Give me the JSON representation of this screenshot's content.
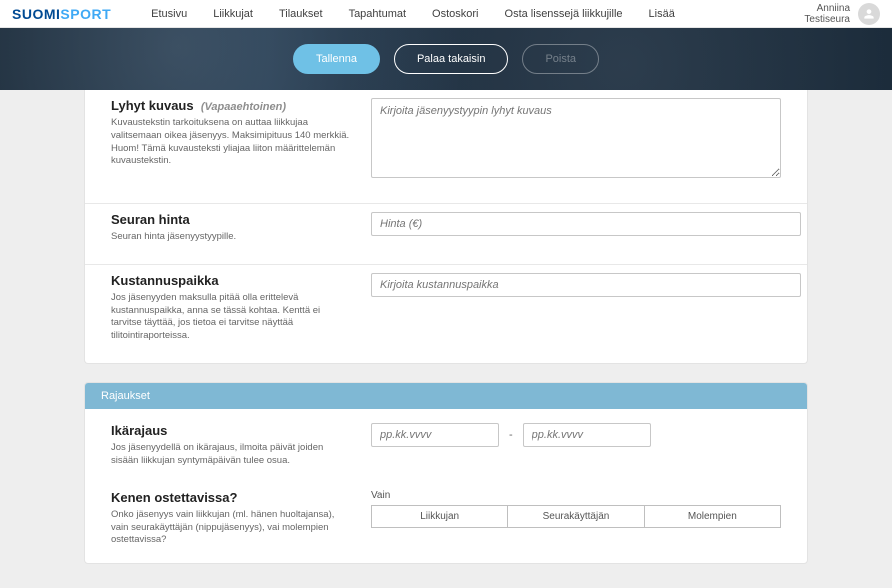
{
  "header": {
    "logo_part1": "SUOMI",
    "logo_part2": "SPORT",
    "nav": [
      "Etusivu",
      "Liikkujat",
      "Tilaukset",
      "Tapahtumat",
      "Ostoskori",
      "Osta lisenssejä liikkujille",
      "Lisää"
    ],
    "user_name": "Anniina",
    "user_org": "Testiseura"
  },
  "hero": {
    "save": "Tallenna",
    "back": "Palaa takaisin",
    "delete": "Poista"
  },
  "form": {
    "short_desc_label": "Lyhyt kuvaus",
    "short_desc_optional": "(Vapaaehtoinen)",
    "short_desc_help": "Kuvaustekstin tarkoituksena on auttaa liikkujaa valitsemaan oikea jäsenyys. Maksimipituus 140 merkkiä. Huom! Tämä kuvausteksti yliajaa liiton määrittelemän kuvaustekstin.",
    "short_desc_placeholder": "Kirjoita jäsenyystyypin lyhyt kuvaus",
    "club_price_label": "Seuran hinta",
    "club_price_help": "Seuran hinta jäsenyystyypille.",
    "club_price_placeholder": "Hinta (€)",
    "cost_center_label": "Kustannuspaikka",
    "cost_center_help": "Jos jäsenyyden maksulla pitää olla erittelevä kustannuspaikka, anna se tässä kohtaa. Kenttä ei tarvitse täyttää, jos tietoa ei tarvitse näyttää tilitointiraporteissa.",
    "cost_center_placeholder": "Kirjoita kustannuspaikka"
  },
  "limits": {
    "stripe": "Rajaukset",
    "age_label": "Ikärajaus",
    "age_help": "Jos jäsenyydellä on ikärajaus, ilmoita päivät joiden sisään liikkujan syntymäpäivän tulee osua.",
    "date_placeholder": "pp.kk.vvvv",
    "dash": "-",
    "who_label": "Kenen ostettavissa?",
    "who_help": "Onko jäsenyys vain liikkujan (ml. hänen huoltajansa), vain seurakäyttäjän (nippujäsenyys), vai molempien ostettavissa?",
    "vain": "Vain",
    "seg": [
      "Liikkujan",
      "Seurakäyttäjän",
      "Molempien"
    ]
  }
}
